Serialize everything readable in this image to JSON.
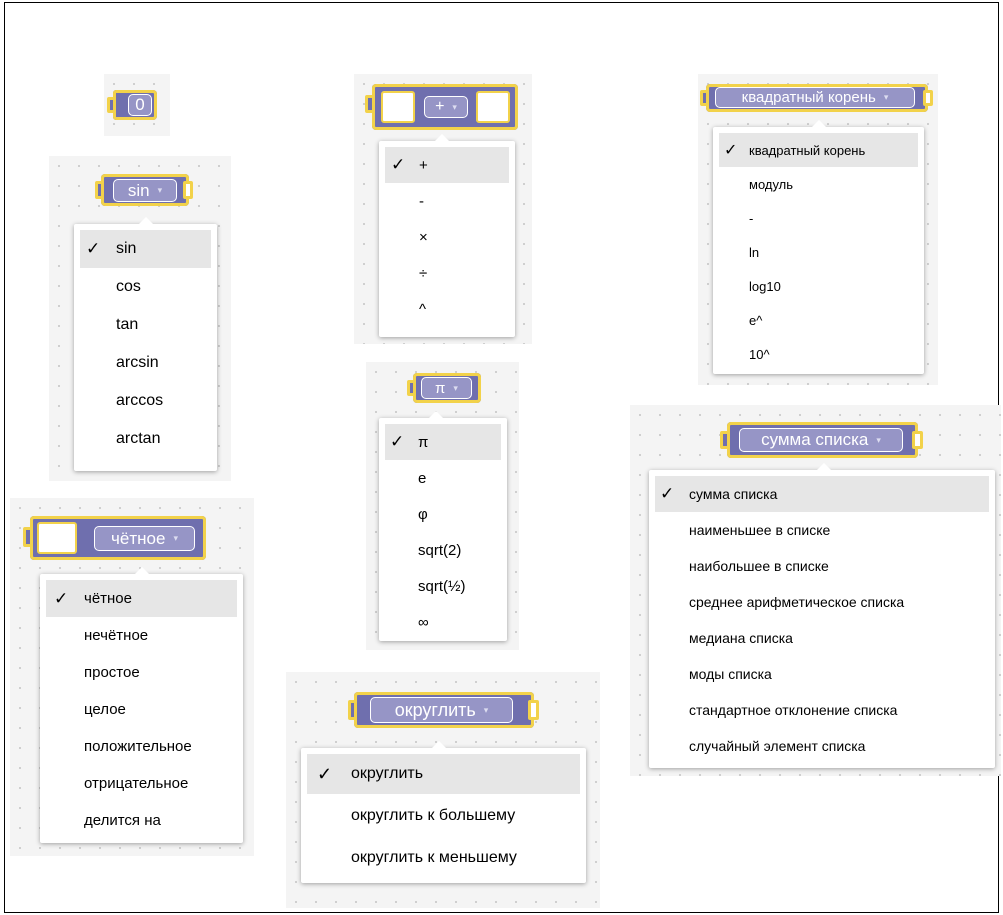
{
  "number_block": {
    "value": "0"
  },
  "trig": {
    "selected": "sin",
    "options": [
      "sin",
      "cos",
      "tan",
      "arcsin",
      "arccos",
      "arctan"
    ]
  },
  "arith": {
    "selected": "+",
    "options": [
      "+",
      "-",
      "×",
      "÷",
      "^"
    ]
  },
  "single": {
    "selected": "квадратный корень",
    "options": [
      "квадратный корень",
      "модуль",
      "-",
      "ln",
      "log10",
      "e^",
      "10^"
    ]
  },
  "constant": {
    "selected": "π",
    "options": [
      "π",
      "e",
      "φ",
      "sqrt(2)",
      "sqrt(½)",
      "∞"
    ]
  },
  "property": {
    "selected": "чётное",
    "options": [
      "чётное",
      "нечётное",
      "простое",
      "целое",
      "положительное",
      "отрицательное",
      "делится на"
    ]
  },
  "round": {
    "selected": "округлить",
    "options": [
      "округлить",
      "округлить к большему",
      "округлить к меньшему"
    ]
  },
  "list_ops": {
    "selected": "сумма списка",
    "options": [
      "сумма списка",
      "наименьшее в списке",
      "наибольшее в списке",
      "среднее арифметическое списка",
      "медиана списка",
      "моды списка",
      "стандартное отклонение списка",
      "случайный элемент списка"
    ]
  },
  "ui": {
    "check_mark": "✓",
    "dropdown_arrow": "▾"
  },
  "colors": {
    "block": "#6f6fae",
    "block_border": "#f2d24a",
    "dropdown": "#9695c6",
    "selected_row": "#e6e6e6"
  }
}
